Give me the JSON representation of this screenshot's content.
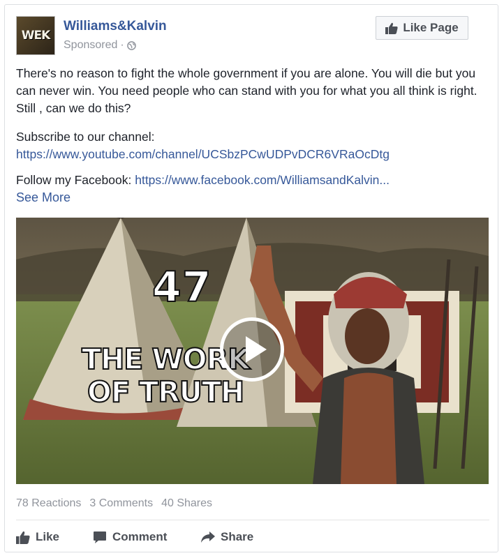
{
  "post": {
    "page_name": "Williams&Kalvin",
    "avatar_text": "WEK",
    "sponsored_label": "Sponsored",
    "separator": "·",
    "like_page_label": "Like Page",
    "body_text": "There's no reason to fight the whole government if you are alone. You will die but you can never win. You need people who can stand with you for what you all think is right. Still , can we do this?",
    "subscribe_label": "Subscribe to our channel:",
    "youtube_link": "https://www.youtube.com/channel/UCSbzPCwUDPvDCR6VRaOcDtg",
    "follow_label": "Follow my Facebook:",
    "facebook_link": "https://www.facebook.com/WilliamsandKalvin...",
    "see_more_label": "See More"
  },
  "video": {
    "number_text": "47",
    "title_line1": "THE WORK",
    "title_line2": "OF TRUTH",
    "play_icon": "play-icon"
  },
  "stats": {
    "reactions": "78 Reactions",
    "comments": "3 Comments",
    "shares": "40 Shares"
  },
  "actions": {
    "like": "Like",
    "comment": "Comment",
    "share": "Share"
  },
  "colors": {
    "link": "#365899",
    "muted": "#90949c",
    "text": "#1d2129",
    "button_bg": "#f6f7f9"
  }
}
